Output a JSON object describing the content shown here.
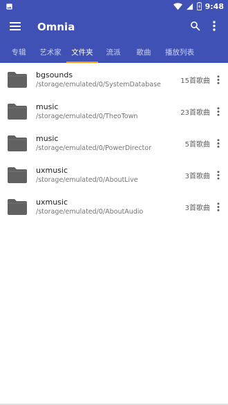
{
  "status_bar": {
    "time": "9:48",
    "icons": [
      "image-notification-icon",
      "wifi-icon",
      "signal-icon",
      "battery-icon"
    ]
  },
  "app_bar": {
    "title": "Omnia",
    "icons": [
      "menu-icon",
      "search-icon",
      "more-vert-icon"
    ]
  },
  "tabs": [
    {
      "label": "专辑"
    },
    {
      "label": "艺术家"
    },
    {
      "label": "文件夹",
      "active": true
    },
    {
      "label": "流派"
    },
    {
      "label": "歌曲"
    },
    {
      "label": "播放列表"
    }
  ],
  "folders": [
    {
      "name": "bgsounds",
      "path": "/storage/emulated/0/SystemDatabase",
      "count": "15首歌曲"
    },
    {
      "name": "music",
      "path": "/storage/emulated/0/TheoTown",
      "count": "23首歌曲"
    },
    {
      "name": "music",
      "path": "/storage/emulated/0/PowerDirector",
      "count": "5首歌曲"
    },
    {
      "name": "uxmusic",
      "path": "/storage/emulated/0/AboutLive",
      "count": "3首歌曲"
    },
    {
      "name": "uxmusic",
      "path": "/storage/emulated/0/AboutAudio",
      "count": "3首歌曲"
    }
  ],
  "colors": {
    "primary": "#3f51b5",
    "tab_indicator": "#ff9800",
    "folder_icon": "#616161"
  }
}
